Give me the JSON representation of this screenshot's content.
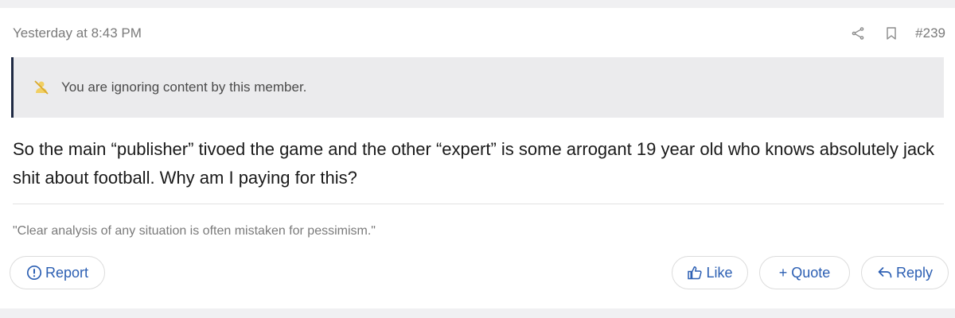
{
  "post": {
    "date": "Yesterday at 8:43 PM",
    "post_number": "#239",
    "share_icon": "share-icon",
    "bookmark_icon": "bookmark-icon",
    "ignore_notice": {
      "icon": "muted-user-icon",
      "text": "You are ignoring content by this member."
    },
    "body": "So the main “publisher” tivoed the game and the other “expert” is some arrogant 19 year old who knows absolutely jack shit about football. Why am I paying for this?",
    "signature": "\"Clear analysis of any situation is often mistaken for pessimism.\""
  },
  "actions": {
    "report_label": "Report",
    "like_label": "Like",
    "quote_label": "+ Quote",
    "reply_label": "Reply"
  },
  "colors": {
    "accent": "#2c5fb3",
    "notice_bar": "#1f2a44",
    "notice_bg": "#ebebed",
    "muted_icon": "#e8c24a"
  }
}
